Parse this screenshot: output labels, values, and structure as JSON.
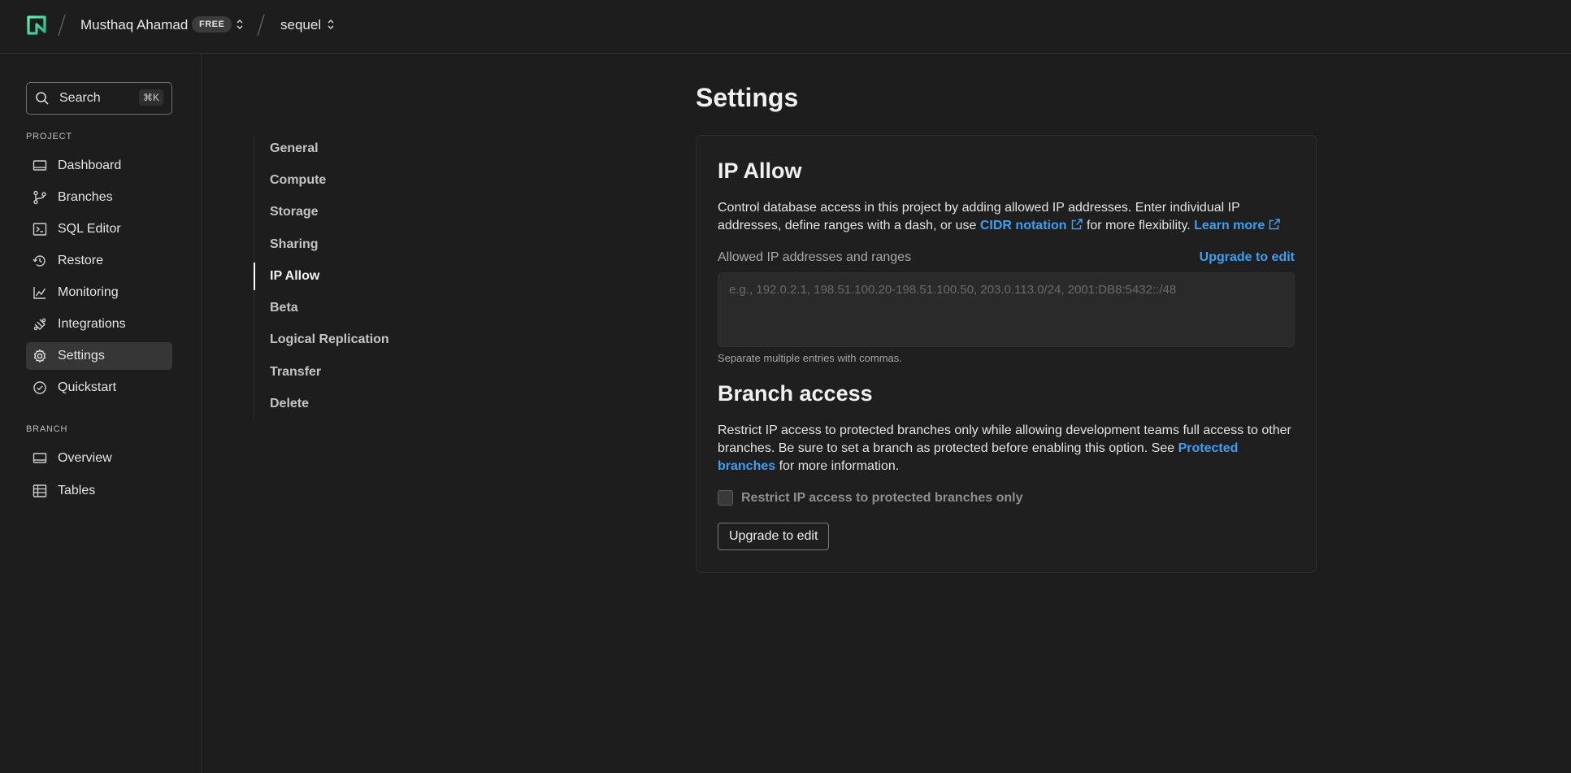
{
  "topbar": {
    "org_name": "Musthaq Ahamad",
    "plan_badge": "FREE",
    "project_name": "sequel"
  },
  "sidebar": {
    "search": {
      "label": "Search",
      "shortcut": "⌘K"
    },
    "project_section": "PROJECT",
    "project_items": [
      {
        "label": "Dashboard",
        "icon": "monitor-icon"
      },
      {
        "label": "Branches",
        "icon": "git-branch-icon"
      },
      {
        "label": "SQL Editor",
        "icon": "sql-editor-icon"
      },
      {
        "label": "Restore",
        "icon": "history-icon"
      },
      {
        "label": "Monitoring",
        "icon": "chart-line-icon"
      },
      {
        "label": "Integrations",
        "icon": "integrations-icon"
      },
      {
        "label": "Settings",
        "icon": "gear-icon",
        "active": true
      },
      {
        "label": "Quickstart",
        "icon": "check-circle-icon"
      }
    ],
    "branch_section": "BRANCH",
    "branch_items": [
      {
        "label": "Overview",
        "icon": "monitor-icon"
      },
      {
        "label": "Tables",
        "icon": "table-icon"
      }
    ]
  },
  "settings_nav": {
    "items": [
      "General",
      "Compute",
      "Storage",
      "Sharing",
      "IP Allow",
      "Beta",
      "Logical Replication",
      "Transfer",
      "Delete"
    ],
    "active": "IP Allow"
  },
  "main": {
    "page_title": "Settings",
    "ip_allow": {
      "title": "IP Allow",
      "desc_part1": "Control database access in this project by adding allowed IP addresses. Enter individual IP addresses, define ranges with a dash, or use ",
      "cidr_link": "CIDR notation",
      "desc_part2": " for more flexibility. ",
      "learn_more_link": "Learn more",
      "field_label": "Allowed IP addresses and ranges",
      "upgrade_link": "Upgrade to edit",
      "textarea_value": "",
      "textarea_placeholder": "e.g., 192.0.2.1, 198.51.100.20-198.51.100.50, 203.0.113.0/24, 2001:DB8:5432::/48",
      "help_text": "Separate multiple entries with commas."
    },
    "branch_access": {
      "title": "Branch access",
      "desc_part1": "Restrict IP access to protected branches only while allowing development teams full access to other branches. Be sure to set a branch as protected before enabling this option. See ",
      "protected_link": "Protected branches",
      "desc_part2": " for more information.",
      "checkbox_label": "Restrict IP access to protected branches only",
      "checkbox_checked": false,
      "button_label": "Upgrade to edit"
    }
  },
  "colors": {
    "background": "#1d1d1d",
    "link": "#3b9ff3",
    "brand_logo": "#38e0a4"
  }
}
